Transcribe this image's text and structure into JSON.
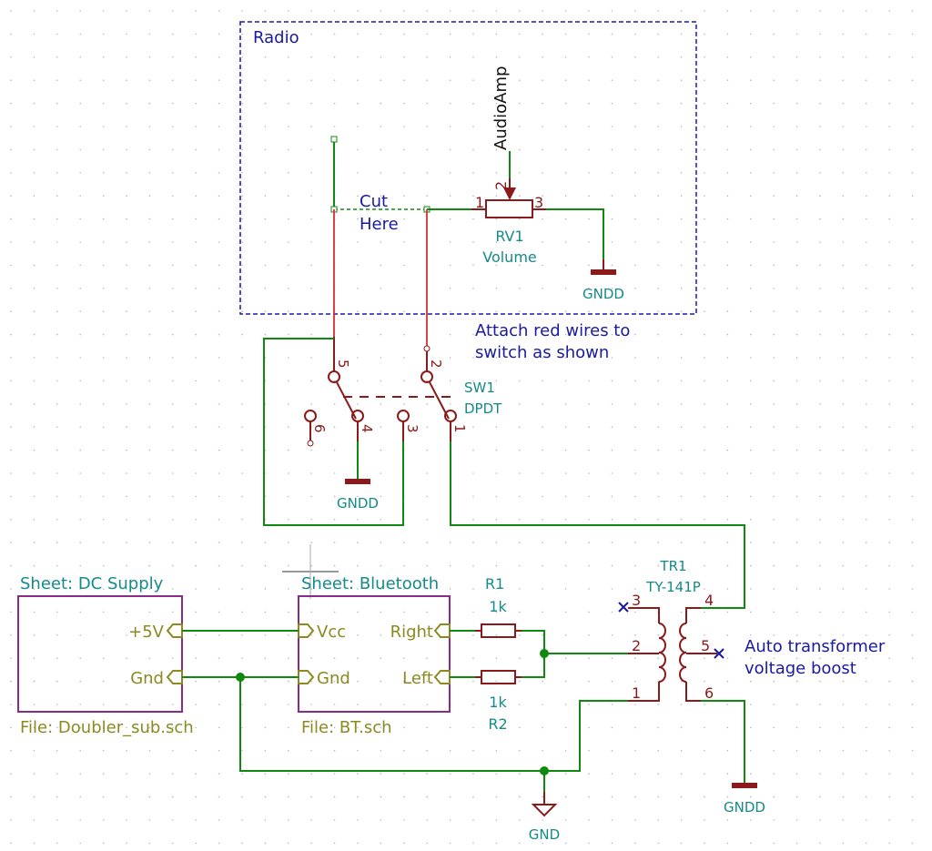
{
  "colors": {
    "wire": "#0f8a0f",
    "red_wire": "#d83030",
    "symbol": "#8b1a1a",
    "sheet_border": "#8a2a8a",
    "sheet_pin": "#8a8a20",
    "note_text": "#1a1aa0",
    "ref_text": "#148a8a"
  },
  "radio_box": {
    "title": "Radio",
    "note_cut": [
      "Cut",
      "Here"
    ],
    "global_label": "AudioAmp"
  },
  "rv1": {
    "ref": "RV1",
    "value": "Volume",
    "pins": [
      "1",
      "2",
      "3"
    ]
  },
  "gndd_labels": [
    "GNDD",
    "GNDD",
    "GNDD"
  ],
  "attach_note": [
    "Attach red wires to",
    "switch as shown"
  ],
  "sw1": {
    "ref": "SW1",
    "value": "DPDT",
    "pins": [
      "1",
      "2",
      "3",
      "4",
      "5",
      "6"
    ]
  },
  "sheet_dc": {
    "title": "Sheet: DC Supply",
    "file": "File: Doubler_sub.sch",
    "pins": [
      "+5V",
      "Gnd"
    ]
  },
  "sheet_bt": {
    "title": "Sheet: Bluetooth",
    "file": "File: BT.sch",
    "pins_left": [
      "Vcc",
      "Gnd"
    ],
    "pins_right": [
      "Right",
      "Left"
    ]
  },
  "r1": {
    "ref": "R1",
    "value": "1k"
  },
  "r2": {
    "ref": "R2",
    "value": "1k"
  },
  "tr1": {
    "ref": "TR1",
    "value": "TY-141P",
    "pins": [
      "1",
      "2",
      "3",
      "4",
      "5",
      "6"
    ]
  },
  "transformer_note": [
    "Auto transformer",
    "voltage boost"
  ],
  "gnd_label": "GND"
}
